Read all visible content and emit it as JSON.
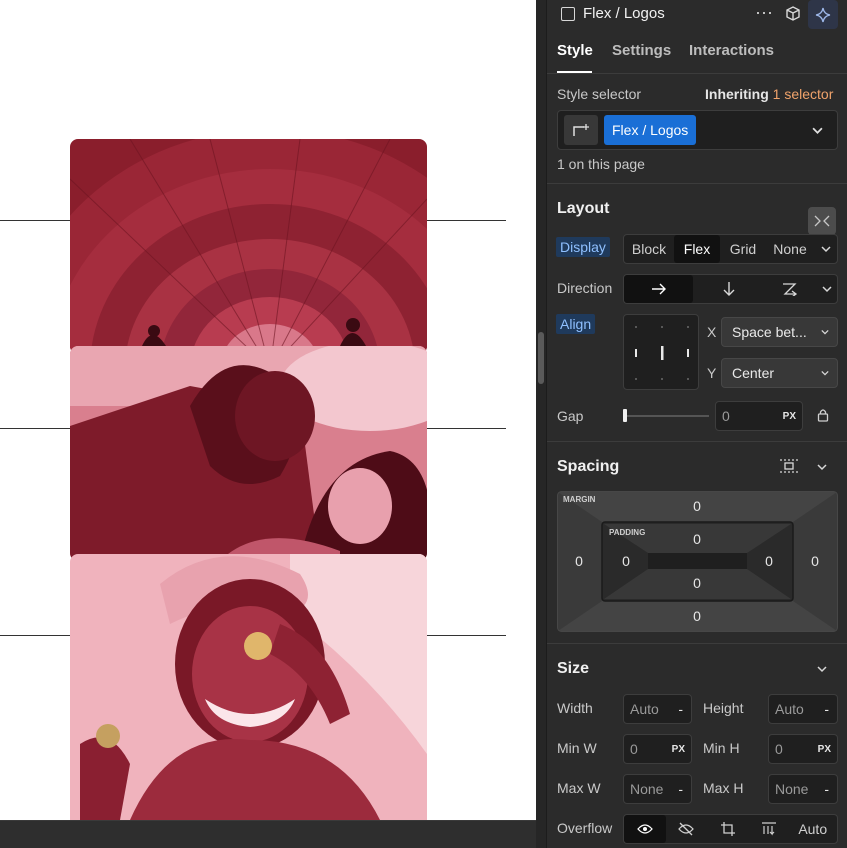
{
  "panel": {
    "element_name": "Flex / Logos",
    "more_label": "···",
    "tabs": [
      "Style",
      "Settings",
      "Interactions"
    ],
    "style_selector_label": "Style selector",
    "inheriting_prefix": "Inheriting",
    "inheriting_count": "1 selector",
    "selector_tag": "Flex / Logos",
    "on_page": "1 on this page"
  },
  "layout": {
    "title": "Layout",
    "display_label": "Display",
    "display_options": [
      "Block",
      "Flex",
      "Grid",
      "None"
    ],
    "display_selected": "Flex",
    "direction_label": "Direction",
    "align_label": "Align",
    "x_label": "X",
    "x_value": "Space bet...",
    "y_label": "Y",
    "y_value": "Center",
    "gap_label": "Gap",
    "gap_value": "0",
    "gap_unit": "PX"
  },
  "spacing": {
    "title": "Spacing",
    "margin_label": "MARGIN",
    "padding_label": "PADDING",
    "margin": {
      "top": "0",
      "right": "0",
      "bottom": "0",
      "left": "0"
    },
    "padding": {
      "top": "0",
      "right": "0",
      "bottom": "0",
      "left": "0"
    }
  },
  "size": {
    "title": "Size",
    "width_label": "Width",
    "width_value": "Auto",
    "height_label": "Height",
    "height_value": "Auto",
    "minw_label": "Min W",
    "minw_value": "0",
    "minw_unit": "PX",
    "minh_label": "Min H",
    "minh_value": "0",
    "minh_unit": "PX",
    "maxw_label": "Max W",
    "maxw_value": "None",
    "maxh_label": "Max H",
    "maxh_value": "None",
    "dash": "-",
    "overflow_label": "Overflow",
    "overflow_auto": "Auto"
  },
  "colors": {
    "accent_blue": "#1a6fd6",
    "inherit_orange": "#f0a36b",
    "card_tint": "#c43a4f"
  }
}
